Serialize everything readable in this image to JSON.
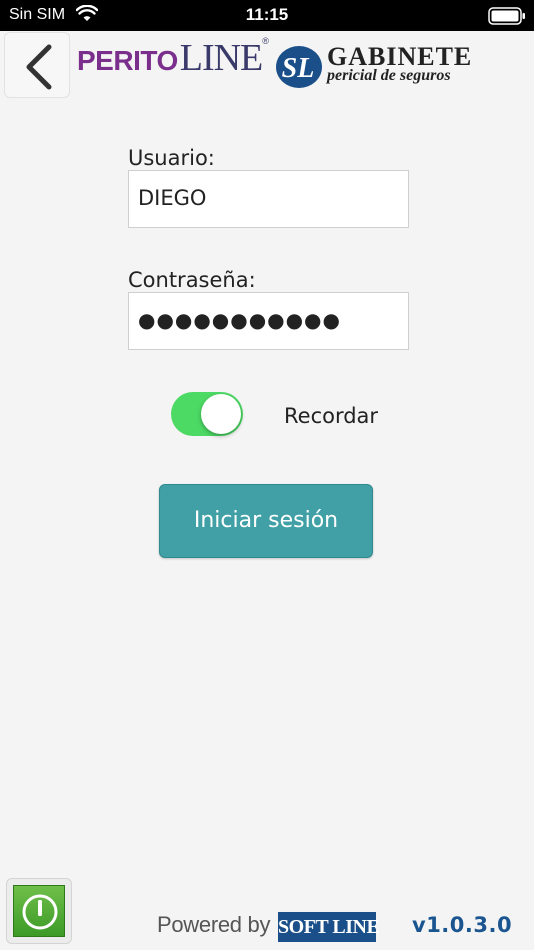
{
  "status_bar": {
    "carrier": "Sin SIM",
    "time": "11:15",
    "wifi_icon": "wifi-icon",
    "battery_icon": "battery-icon"
  },
  "header": {
    "back_icon": "chevron-left-icon",
    "logo_perito": "PERITO",
    "logo_line": "LINE",
    "logo_reg": "®",
    "gabinete_mark": "SL",
    "gabinete_title": "GABINETE",
    "gabinete_subtitle": "pericial de seguros"
  },
  "form": {
    "user_label": "Usuario:",
    "user_value": "DIEGO",
    "password_label": "Contraseña:",
    "password_value": "●●●●●●●●●●●",
    "remember_label": "Recordar",
    "remember_on": true,
    "login_label": "Iniciar sesión"
  },
  "footer": {
    "power_icon": "power-icon",
    "powered_by": "Powered by",
    "softline": "SOFT LINE",
    "version": "v1.0.3.0"
  },
  "colors": {
    "accent_button": "#40a0a6",
    "toggle_on": "#4cd964",
    "perito_purple": "#7b2f8c",
    "softline_blue": "#1a4f8a",
    "version_blue": "#1a5590",
    "background": "#f4f4f4"
  }
}
